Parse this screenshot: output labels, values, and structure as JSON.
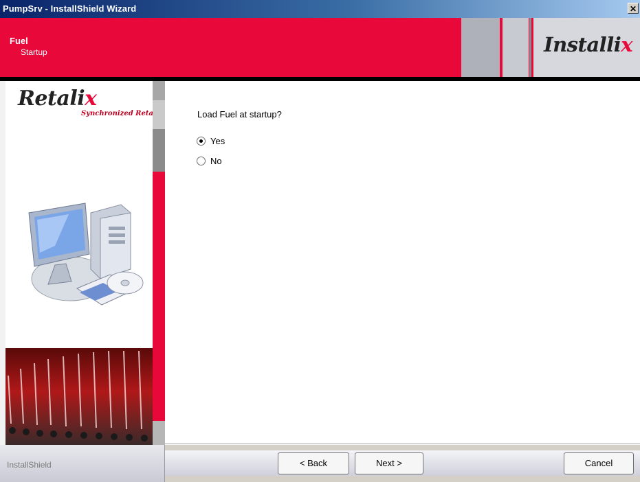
{
  "window": {
    "title": "PumpSrv - InstallShield Wizard",
    "close_label": "✕"
  },
  "header": {
    "title": "Fuel",
    "subtitle": "Startup",
    "logo_prefix": "Installi",
    "logo_suffix": "x"
  },
  "sidebar": {
    "logo_prefix": "Retali",
    "logo_suffix": "x",
    "tagline": "Synchronized Retail"
  },
  "main": {
    "question": "Load Fuel at startup?",
    "options": [
      {
        "label": "Yes",
        "selected": true
      },
      {
        "label": "No",
        "selected": false
      }
    ]
  },
  "footer": {
    "brand": "InstallShield",
    "back_label": "< Back",
    "next_label": "Next >",
    "cancel_label": "Cancel"
  },
  "colors": {
    "accent_red": "#e8083a",
    "title_blue": "#0a246a"
  }
}
